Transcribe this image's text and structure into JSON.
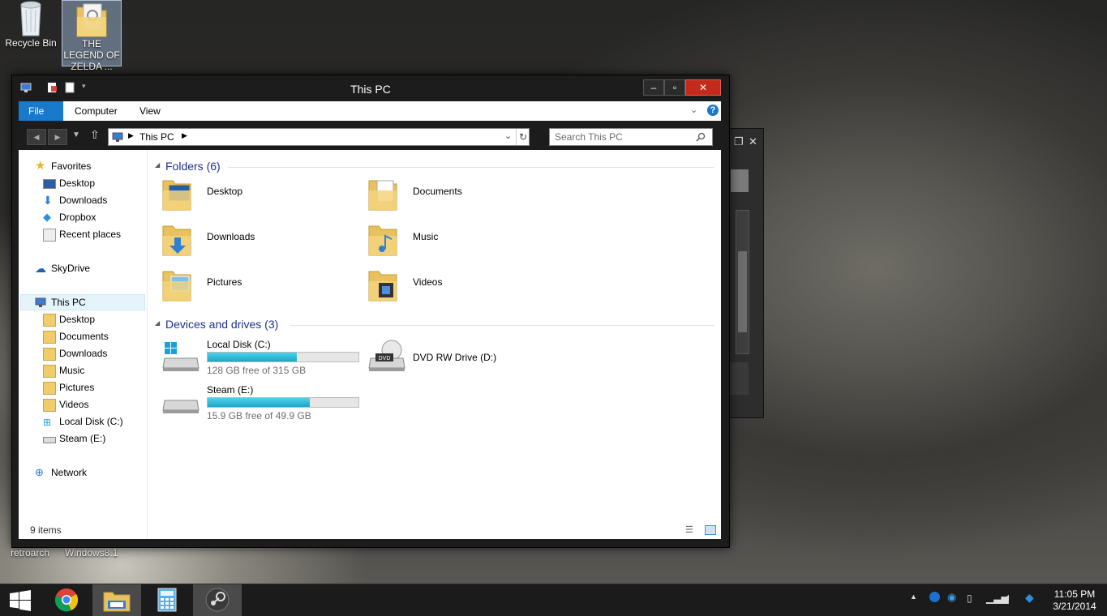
{
  "desktop": {
    "icons": [
      {
        "label": "Recycle Bin",
        "icon": "recycle-bin-icon"
      },
      {
        "label": "THE LEGEND OF ZELDA ...",
        "icon": "folder-icon"
      }
    ],
    "bottom_labels": [
      "retroarch",
      "Windows8.1"
    ]
  },
  "window": {
    "title": "This PC",
    "ribbon_tabs": [
      "File",
      "Computer",
      "View"
    ],
    "address": "This PC",
    "search_placeholder": "Search This PC",
    "status": "9 items"
  },
  "nav": {
    "favorites": "Favorites",
    "favorites_items": [
      "Desktop",
      "Downloads",
      "Dropbox",
      "Recent places"
    ],
    "skydrive": "SkyDrive",
    "thispc": "This PC",
    "thispc_items": [
      "Desktop",
      "Documents",
      "Downloads",
      "Music",
      "Pictures",
      "Videos",
      "Local Disk (C:)",
      "Steam (E:)"
    ],
    "network": "Network"
  },
  "main": {
    "folders_header": "Folders (6)",
    "folders": [
      "Desktop",
      "Documents",
      "Downloads",
      "Music",
      "Pictures",
      "Videos"
    ],
    "drives_header": "Devices and drives (3)",
    "drives": [
      {
        "name": "Local Disk (C:)",
        "free": "128 GB free of 315 GB",
        "used_fraction": 0.59
      },
      {
        "name": "DVD RW Drive (D:)"
      },
      {
        "name": "Steam (E:)",
        "free": "15.9 GB free of 49.9 GB",
        "used_fraction": 0.68
      }
    ]
  },
  "taskbar": {
    "time": "11:05 PM",
    "date": "3/21/2014",
    "apps": [
      "start-icon",
      "chrome-icon",
      "file-explorer-icon",
      "calculator-icon",
      "steam-icon"
    ]
  },
  "colors": {
    "accent": "#1979ca",
    "close_button": "#c42b1c",
    "group_header": "#1e3287",
    "drive_bar": "#26b2d4"
  }
}
